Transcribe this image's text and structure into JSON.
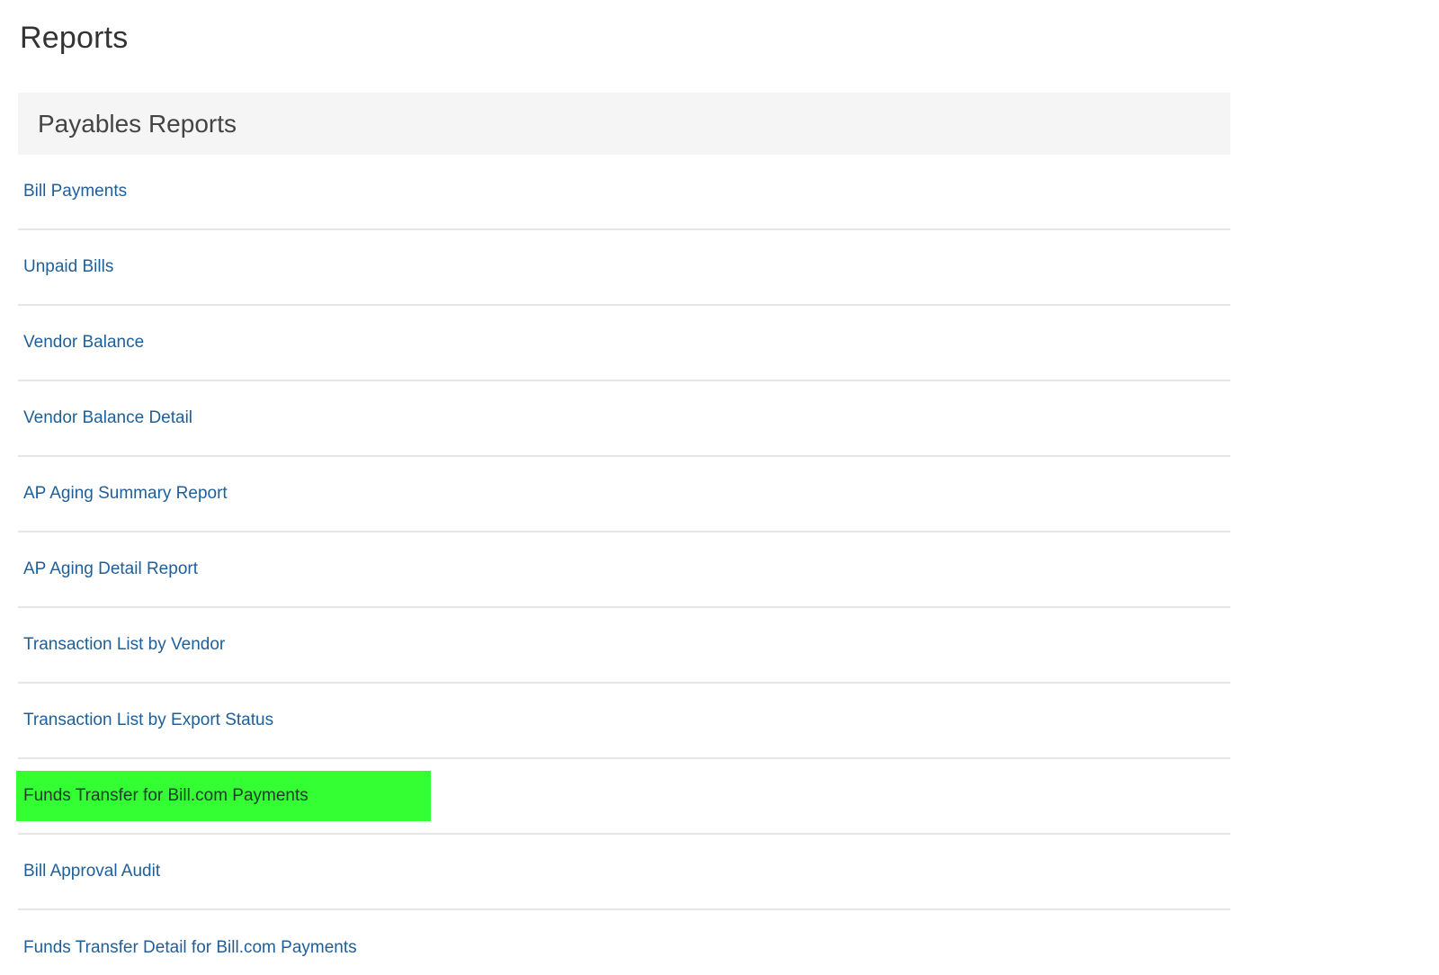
{
  "page": {
    "title": "Reports"
  },
  "section": {
    "title": "Payables Reports",
    "highlight_color": "#33ff33",
    "link_color": "#1f5f99",
    "reports": [
      {
        "label": "Bill Payments",
        "highlighted": false
      },
      {
        "label": "Unpaid Bills",
        "highlighted": false
      },
      {
        "label": "Vendor Balance",
        "highlighted": false
      },
      {
        "label": "Vendor Balance Detail",
        "highlighted": false
      },
      {
        "label": "AP Aging Summary Report",
        "highlighted": false
      },
      {
        "label": "AP Aging Detail Report",
        "highlighted": false
      },
      {
        "label": "Transaction List by Vendor",
        "highlighted": false
      },
      {
        "label": "Transaction List by Export Status",
        "highlighted": false
      },
      {
        "label": "Funds Transfer for Bill.com Payments",
        "highlighted": true
      },
      {
        "label": "Bill Approval Audit",
        "highlighted": false
      },
      {
        "label": "Funds Transfer Detail for Bill.com Payments",
        "highlighted": false
      }
    ]
  }
}
